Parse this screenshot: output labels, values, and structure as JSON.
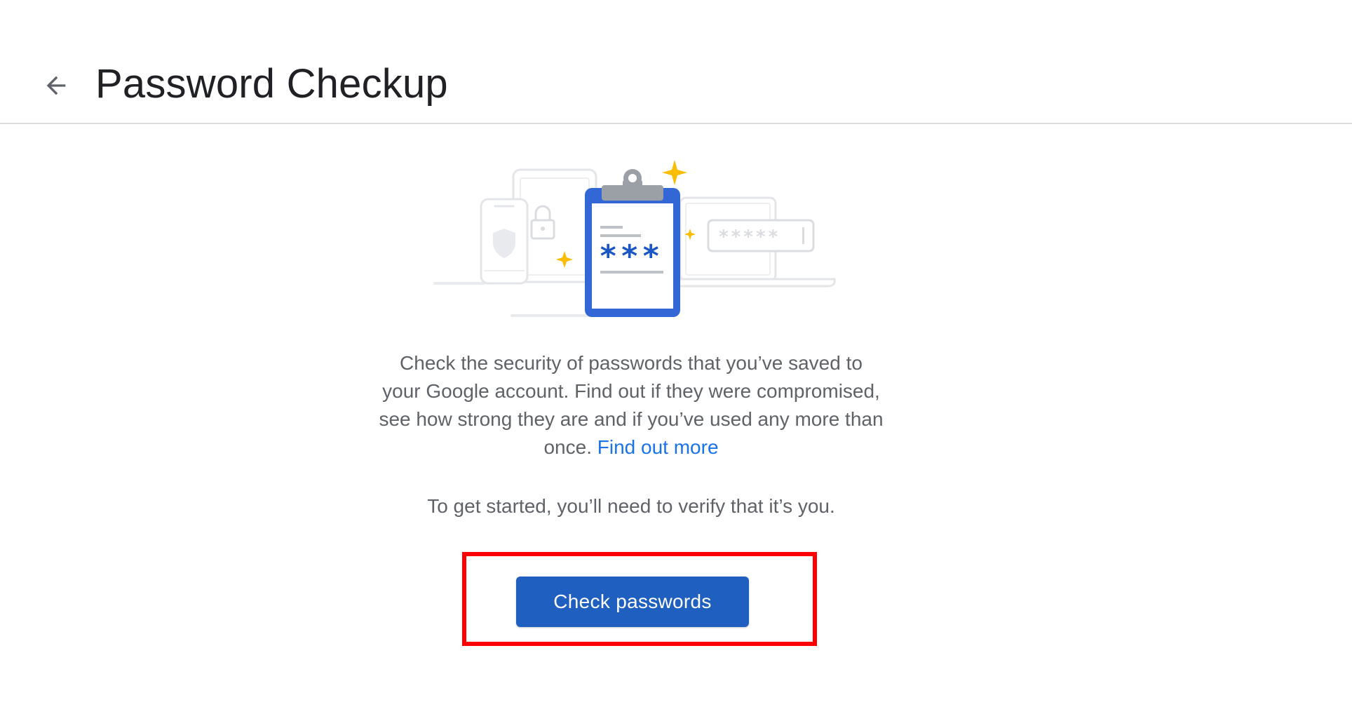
{
  "header": {
    "back_icon": "arrow-back-icon",
    "title": "Password Checkup"
  },
  "illustration": {
    "icons": [
      "phone-icon",
      "shield-icon",
      "tablet-icon",
      "lock-icon",
      "clipboard-icon",
      "sparkle-icon",
      "laptop-icon",
      "password-field-icon"
    ],
    "clipboard_text": "***",
    "password_field_text": "*****",
    "colors": {
      "clipboard_blue": "#4285f4",
      "sparkle_yellow": "#fbbc04",
      "device_gray": "#dadce0"
    }
  },
  "content": {
    "description": "Check the security of passwords that you’ve saved to your Google account. Find out if they were compromised, see how strong they are and if you’ve used any more than once.",
    "find_out_more_link": "Find out more",
    "verify_text": "To get started, you’ll need to verify that it’s you."
  },
  "actions": {
    "check_passwords_label": "Check passwords",
    "primary_color": "#1f5fbf",
    "highlight_color": "#ff0000"
  }
}
